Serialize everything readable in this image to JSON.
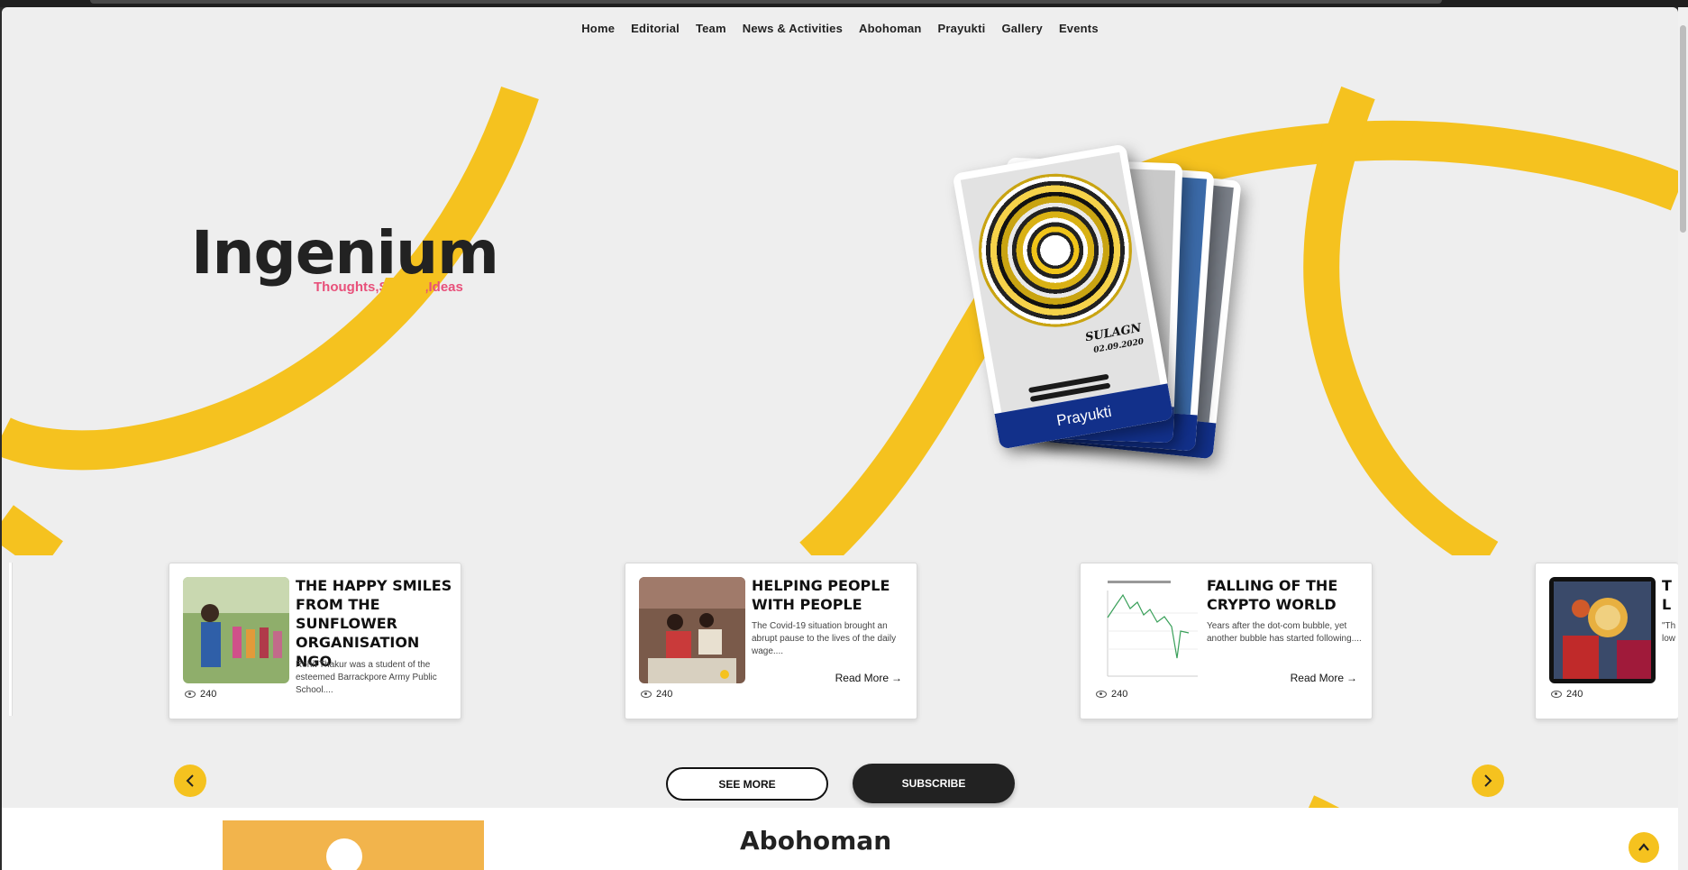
{
  "nav": {
    "items": [
      "Home",
      "Editorial",
      "Team",
      "News & Activities",
      "Abohoman",
      "Prayukti",
      "Gallery",
      "Events"
    ]
  },
  "brand": {
    "title": "Ingenium",
    "tagline": "Thoughts,Stories,Ideas"
  },
  "featured": {
    "card_label": "Prayukti",
    "signature": "SULAGN",
    "signature_date": "02.09.2020"
  },
  "articles": [
    {
      "title": "THE HAPPY SMILES FROM THE SUNFLOWER ORGANISATION NGO",
      "desc": "Rohit Thakur was a student of the esteemed Barrackpore Army Public School....",
      "views": "240",
      "read_more": ""
    },
    {
      "title": "HELPING PEOPLE WITH PEOPLE",
      "desc": "The Covid-19 situation brought an abrupt pause to the lives of the daily wage....",
      "views": "240",
      "read_more": "Read More"
    },
    {
      "title": "FALLING OF THE CRYPTO WORLD",
      "desc": "Years after the dot-com bubble, yet another bubble has started following....",
      "views": "240",
      "read_more": "Read More"
    },
    {
      "title": "T L",
      "desc": "\"Th low",
      "views": "240",
      "read_more": ""
    }
  ],
  "buttons": {
    "see_more": "SEE MORE",
    "subscribe": "SUBSCRIBE"
  },
  "lower": {
    "title": "Abohoman"
  },
  "colors": {
    "accent": "#f5c21f",
    "dark": "#222222",
    "pink": "#e8507a",
    "navy": "#12308a",
    "bg": "#eeeeee"
  },
  "icons": [
    "eye-icon",
    "arrow-right-icon",
    "chevron-left-icon",
    "chevron-right-icon",
    "chevron-up-icon"
  ]
}
